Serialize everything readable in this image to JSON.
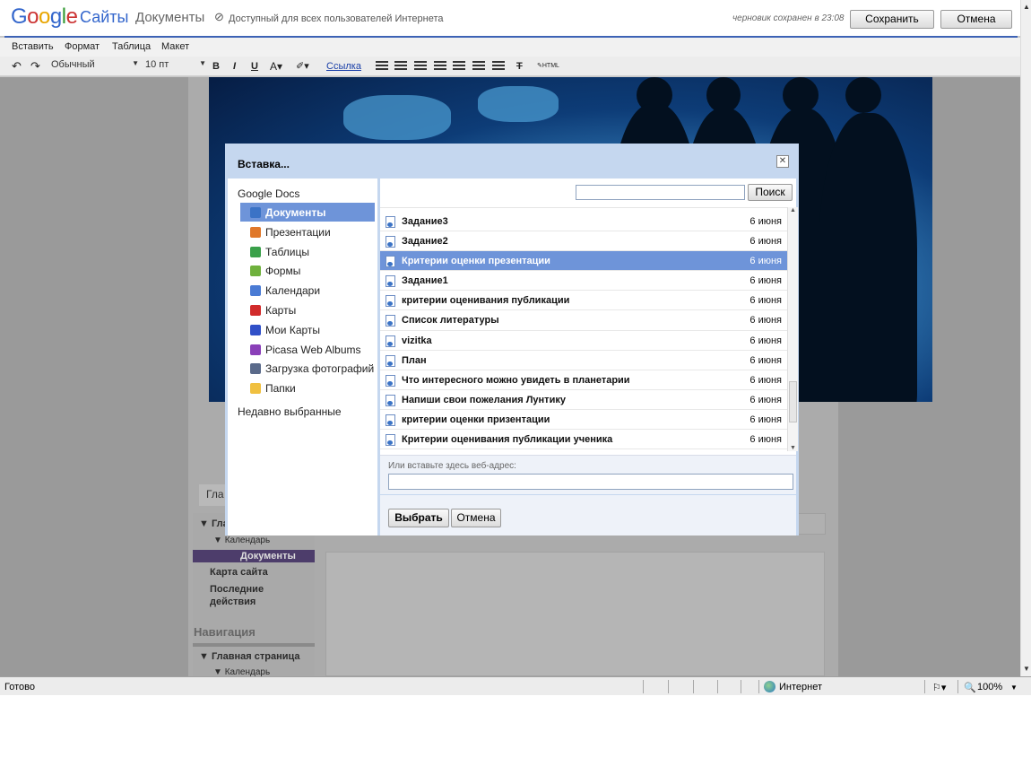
{
  "header": {
    "logo_letters": [
      "G",
      "o",
      "o",
      "g",
      "l",
      "e"
    ],
    "product": "Сайты",
    "page_title": "Документы",
    "publish_icon": "globe-lock-icon",
    "publish_status": "Доступный для всех пользователей Интернета",
    "draft_status": "черновик сохранен в 23:08",
    "save_label": "Сохранить",
    "cancel_label": "Отмена"
  },
  "menu": {
    "items": [
      "Вставить",
      "Формат",
      "Таблица",
      "Макет"
    ]
  },
  "toolbar": {
    "undo_icon": "undo-icon",
    "redo_icon": "redo-icon",
    "style_value": "Обычный",
    "size_value": "10 пт",
    "bold": "B",
    "italic": "I",
    "underline": "U",
    "text_color": "A",
    "link_label": "Ссылка",
    "clear_format": "T",
    "html_label": "HTML"
  },
  "page_behind": {
    "tab_label": "Гла",
    "sidebar_items": [
      "Гла",
      "Календарь",
      "Документы",
      "Карта сайта",
      "Последние",
      "действия"
    ],
    "nav_heading": "Навигация",
    "nav_items": [
      "Главная страница",
      "Календарь"
    ]
  },
  "dialog": {
    "title": "Вставка...",
    "close_icon": "close-icon",
    "source_heading": "Google Docs",
    "sources": [
      {
        "label": "Документы",
        "icon": "documents-icon",
        "color": "#3b73c6",
        "selected": true
      },
      {
        "label": "Презентации",
        "icon": "presentations-icon",
        "color": "#e0782a",
        "selected": false
      },
      {
        "label": "Таблицы",
        "icon": "spreadsheets-icon",
        "color": "#3aa04a",
        "selected": false
      },
      {
        "label": "Формы",
        "icon": "forms-icon",
        "color": "#6fb13d",
        "selected": false
      },
      {
        "label": "Календари",
        "icon": "calendar-icon",
        "color": "#4a7bd4",
        "selected": false
      },
      {
        "label": "Карты",
        "icon": "map-pin-icon",
        "color": "#d12b2b",
        "selected": false
      },
      {
        "label": "Мои Карты",
        "icon": "map-pin-blue-icon",
        "color": "#3050c8",
        "selected": false
      },
      {
        "label": "Picasa Web Albums",
        "icon": "picasa-icon",
        "color": "#8a3fb8",
        "selected": false
      },
      {
        "label": "Загрузка фотографий",
        "icon": "upload-icon",
        "color": "#5a6a8a",
        "selected": false
      },
      {
        "label": "Папки",
        "icon": "folder-icon",
        "color": "#f0c040",
        "selected": false
      }
    ],
    "recent_label": "Недавно выбранные",
    "search_placeholder": "",
    "search_button": "Поиск",
    "documents": [
      {
        "title": "Задание3",
        "date": "6 июня",
        "selected": false
      },
      {
        "title": "Задание2",
        "date": "6 июня",
        "selected": false
      },
      {
        "title": "Критерии оценки презентации",
        "date": "6 июня",
        "selected": true
      },
      {
        "title": "Задание1",
        "date": "6 июня",
        "selected": false
      },
      {
        "title": "критерии оценивания публикации",
        "date": "6 июня",
        "selected": false
      },
      {
        "title": "Список литературы",
        "date": "6 июня",
        "selected": false
      },
      {
        "title": "vizitka",
        "date": "6 июня",
        "selected": false
      },
      {
        "title": "План",
        "date": "6 июня",
        "selected": false
      },
      {
        "title": "Что интересного можно увидеть в планетарии",
        "date": "6 июня",
        "selected": false
      },
      {
        "title": "Напиши свои пожелания Лунтику",
        "date": "6 июня",
        "selected": false
      },
      {
        "title": "критерии оценки призентации",
        "date": "6 июня",
        "selected": false
      },
      {
        "title": "Критерии оценивания публикации ученика",
        "date": "6 июня",
        "selected": false
      }
    ],
    "url_label": "Или вставьте здесь веб-адрес:",
    "url_value": "",
    "choose_button": "Выбрать",
    "cancel_button": "Отмена"
  },
  "annotation": {
    "arrow_color": "#ff0000",
    "arrow_icon": "red-arrow-icon"
  },
  "statusbar": {
    "status": "Готово",
    "zone_icon": "globe-icon",
    "zone": "Интернет",
    "zoom": "100%"
  }
}
